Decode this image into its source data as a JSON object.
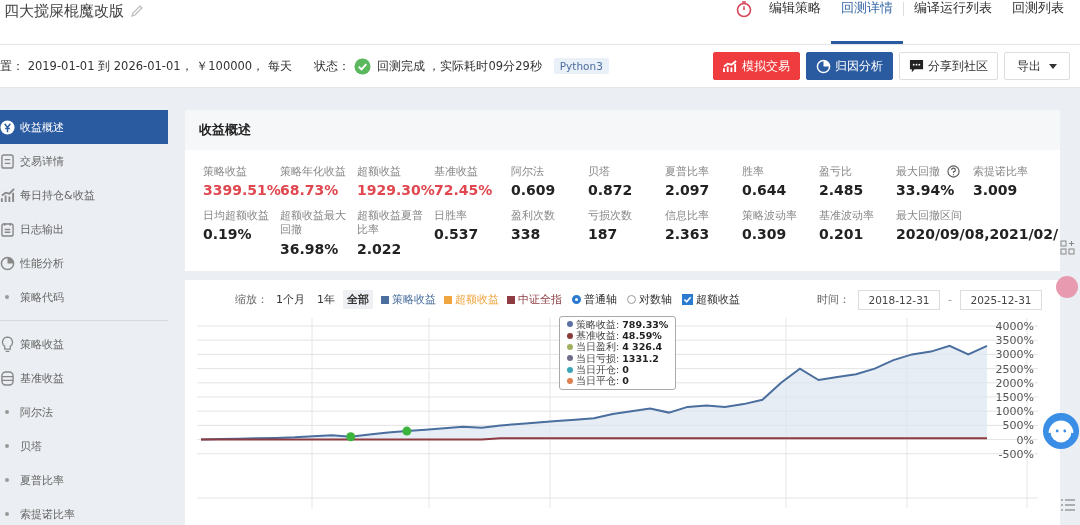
{
  "header": {
    "title": "四大搅屎棍魔改版",
    "tabs": [
      {
        "label": "编辑策略",
        "selected": false
      },
      {
        "label": "回测详情",
        "selected": true
      },
      {
        "label": "编译运行列表",
        "selected": false
      },
      {
        "label": "回测列表",
        "selected": false
      }
    ]
  },
  "info": {
    "settings": "置： 2019-01-01 到 2026-01-01， ￥100000， 每天",
    "status_label": "状态：",
    "done": true,
    "status": "回测完成 ，实际耗时09分29秒",
    "language": "Python3"
  },
  "actions": [
    {
      "label": "模拟交易",
      "kind": "simulate"
    },
    {
      "label": "归因分析",
      "kind": "attribution"
    },
    {
      "label": "分享到社区",
      "kind": "share"
    },
    {
      "label": "导出",
      "kind": "export"
    }
  ],
  "sidebar": {
    "items": [
      {
        "label": "收益概述",
        "kind": "overview",
        "selected": true
      },
      {
        "label": "交易详情",
        "kind": "trades",
        "selected": false
      },
      {
        "label": "每日持仓&收益",
        "kind": "holdings",
        "selected": false
      },
      {
        "label": "日志输出",
        "kind": "log",
        "selected": false
      },
      {
        "label": "性能分析",
        "kind": "performance",
        "selected": false
      },
      {
        "label": "策略代码",
        "kind": "bullet",
        "selected": false
      },
      {
        "label": "策略收益",
        "kind": "idea",
        "selected": false
      },
      {
        "label": "基准收益",
        "kind": "benchmark",
        "selected": false
      },
      {
        "label": "阿尔法",
        "kind": "bullet",
        "selected": false
      },
      {
        "label": "贝塔",
        "kind": "bullet",
        "selected": false
      },
      {
        "label": "夏普比率",
        "kind": "bullet",
        "selected": false
      },
      {
        "label": "索提诺比率",
        "kind": "bullet",
        "selected": false
      }
    ]
  },
  "overview": {
    "title": "收益概述",
    "metrics": [
      {
        "label": "策略收益",
        "value": "3399.51%",
        "color": "#e0474f",
        "help": false
      },
      {
        "label": "策略年化收益",
        "value": "68.73%",
        "color": "#e0474f",
        "help": false
      },
      {
        "label": "超额收益",
        "value": "1929.30%",
        "color": "#e0474f",
        "help": false
      },
      {
        "label": "基准收益",
        "value": "72.45%",
        "color": "#e0474f",
        "help": false
      },
      {
        "label": "阿尔法",
        "value": "0.609",
        "color": "#222222",
        "help": false
      },
      {
        "label": "贝塔",
        "value": "0.872",
        "color": "#222222",
        "help": false
      },
      {
        "label": "夏普比率",
        "value": "2.097",
        "color": "#222222",
        "help": false
      },
      {
        "label": "胜率",
        "value": "0.644",
        "color": "#222222",
        "help": false
      },
      {
        "label": "盈亏比",
        "value": "2.485",
        "color": "#222222",
        "help": false
      },
      {
        "label": "最大回撤",
        "value": "33.94%",
        "color": "#222222",
        "help": true
      },
      {
        "label": "索提诺比率",
        "value": "3.009",
        "color": "#222222",
        "help": false
      },
      {
        "label": "日均超额收益",
        "value": "0.19%",
        "color": "#222222",
        "help": false
      },
      {
        "label": "超额收益最大回撤",
        "value": "36.98%",
        "color": "#222222",
        "help": false
      },
      {
        "label": "超额收益夏普比率",
        "value": "2.022",
        "color": "#222222",
        "help": false
      },
      {
        "label": "日胜率",
        "value": "0.537",
        "color": "#222222",
        "help": false
      },
      {
        "label": "盈利次数",
        "value": "338",
        "color": "#222222",
        "help": false
      },
      {
        "label": "亏损次数",
        "value": "187",
        "color": "#222222",
        "help": false
      },
      {
        "label": "信息比率",
        "value": "2.363",
        "color": "#222222",
        "help": false
      },
      {
        "label": "策略波动率",
        "value": "0.309",
        "color": "#222222",
        "help": false
      },
      {
        "label": "基准波动率",
        "value": "0.201",
        "color": "#222222",
        "help": false
      },
      {
        "label": "最大回撤区间",
        "value": "2020/09/08,2021/02/",
        "color": "#222222",
        "help": false
      }
    ]
  },
  "chart": {
    "zoom_label": "缩放：",
    "zoom_options": [
      {
        "label": "1个月",
        "selected": false
      },
      {
        "label": "1年",
        "selected": false
      },
      {
        "label": "全部",
        "selected": true
      }
    ],
    "legend": [
      {
        "label": "策略收益",
        "color": "#4a6e9e"
      },
      {
        "label": "超额收益",
        "color": "#f0a640"
      },
      {
        "label": "中证全指",
        "color": "#8e3b42"
      }
    ],
    "axis_options": [
      {
        "label": "普通轴",
        "kind": "radio",
        "selected": true
      },
      {
        "label": "对数轴",
        "kind": "radio",
        "selected": false
      },
      {
        "label": "超额收益",
        "kind": "checkbox",
        "checked": true
      }
    ],
    "time_label": "时间：",
    "start": "2018-12-31",
    "range_sep": "-",
    "end": "2025-12-31",
    "tooltip": [
      {
        "label": "策略收益:",
        "value": "789.33%",
        "color": "#5b6fa3"
      },
      {
        "label": "基准收益:",
        "value": "48.59%",
        "color": "#8b3a3a"
      },
      {
        "label": "当日盈利:",
        "value": "4 326.4",
        "color": "#a0b060"
      },
      {
        "label": "当日亏损:",
        "value": "1331.2",
        "color": "#6e6e8a"
      },
      {
        "label": "当日开仓:",
        "value": "0",
        "color": "#3aa6b8"
      },
      {
        "label": "当日平仓:",
        "value": "0",
        "color": "#e08050"
      }
    ],
    "chart_data": {
      "type": "line",
      "grid": true,
      "ylim": [
        -500,
        4000
      ],
      "yticks": [
        {
          "value": 4000,
          "label": "4000%"
        },
        {
          "value": 3500,
          "label": "3500%"
        },
        {
          "value": 3000,
          "label": "3000%"
        },
        {
          "value": 2500,
          "label": "2500%"
        },
        {
          "value": 2000,
          "label": "2000%"
        },
        {
          "value": 1500,
          "label": "1500%"
        },
        {
          "value": 1000,
          "label": "1000%"
        },
        {
          "value": 500,
          "label": "500%"
        },
        {
          "value": 0,
          "label": "0%"
        },
        {
          "value": -500,
          "label": "-500%"
        }
      ],
      "series": [
        {
          "color": "#4a6e9e",
          "values": [
            0,
            20,
            30,
            50,
            60,
            80,
            120,
            150,
            100,
            180,
            250,
            300,
            350,
            400,
            450,
            420,
            500,
            550,
            600,
            650,
            700,
            750,
            900,
            1000,
            1100,
            950,
            1150,
            1200,
            1150,
            1250,
            1400,
            2000,
            2500,
            2100,
            2200,
            2300,
            2500,
            2800,
            3000,
            3100,
            3300,
            3000,
            3300
          ]
        },
        {
          "color": "#8e3b42",
          "values": [
            0,
            0,
            0,
            0,
            0,
            0,
            0,
            0,
            0,
            0,
            0,
            0,
            0,
            0,
            0,
            0,
            50,
            50,
            50,
            50,
            50,
            50,
            50,
            50,
            50,
            50,
            50,
            50,
            50,
            50,
            50,
            50,
            50,
            50,
            50,
            50,
            50,
            50,
            50,
            50,
            50,
            50,
            50
          ]
        }
      ]
    }
  }
}
